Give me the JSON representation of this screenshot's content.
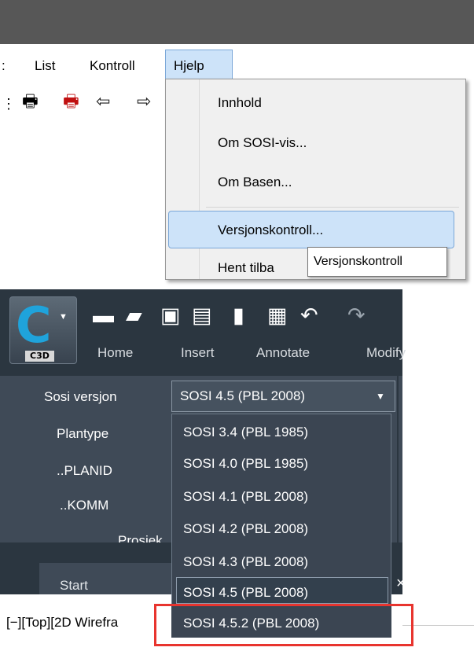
{
  "classic_window": {
    "menubar": {
      "partial_item": ":",
      "items": [
        "List",
        "Kontroll"
      ],
      "active_item": "Hjelp"
    },
    "toolbar_icons": [
      "printer-icon",
      "print-preview-icon",
      "arrow-left-icon",
      "arrow-right-icon"
    ],
    "help_menu": {
      "items": [
        "Innhold",
        "Om SOSI-vis...",
        "Om Basen...",
        "Versjonskontroll...",
        "Hent tilba"
      ],
      "highlighted_item": "Versjonskontroll...",
      "tooltip": "Versjonskontroll"
    }
  },
  "civil3d": {
    "logo_text": "C3D",
    "quick_access_icons": [
      "new-icon",
      "open-icon",
      "save-icon",
      "save-as-icon",
      "import-icon",
      "print-icon",
      "undo-icon",
      "redo-icon"
    ],
    "ribbon_tabs": [
      "Home",
      "Insert",
      "Annotate",
      "Modify"
    ],
    "fields": {
      "sosi_versjon": "Sosi versjon",
      "plantype": "Plantype",
      "planid": "..PLANID",
      "komm": "..KOMM",
      "prosjekt": "Prosjek"
    },
    "combo": {
      "selected": "SOSI 4.5 (PBL 2008)",
      "options": [
        "SOSI 3.4 (PBL 1985)",
        "SOSI 4.0 (PBL 1985)",
        "SOSI 4.1 (PBL 2008)",
        "SOSI 4.2 (PBL 2008)",
        "SOSI 4.3 (PBL 2008)",
        "SOSI 4.5 (PBL 2008)",
        "SOSI 4.5.2 (PBL 2008)"
      ]
    },
    "tabs": {
      "start": "Start",
      "close": "×"
    },
    "viewport_label": "[−][Top][2D Wirefra"
  },
  "colors": {
    "highlight": "#cde3f9",
    "ribbon": "#3f4a57",
    "annotation_red": "#e8342e",
    "logo_blue": "#1fa3db"
  }
}
